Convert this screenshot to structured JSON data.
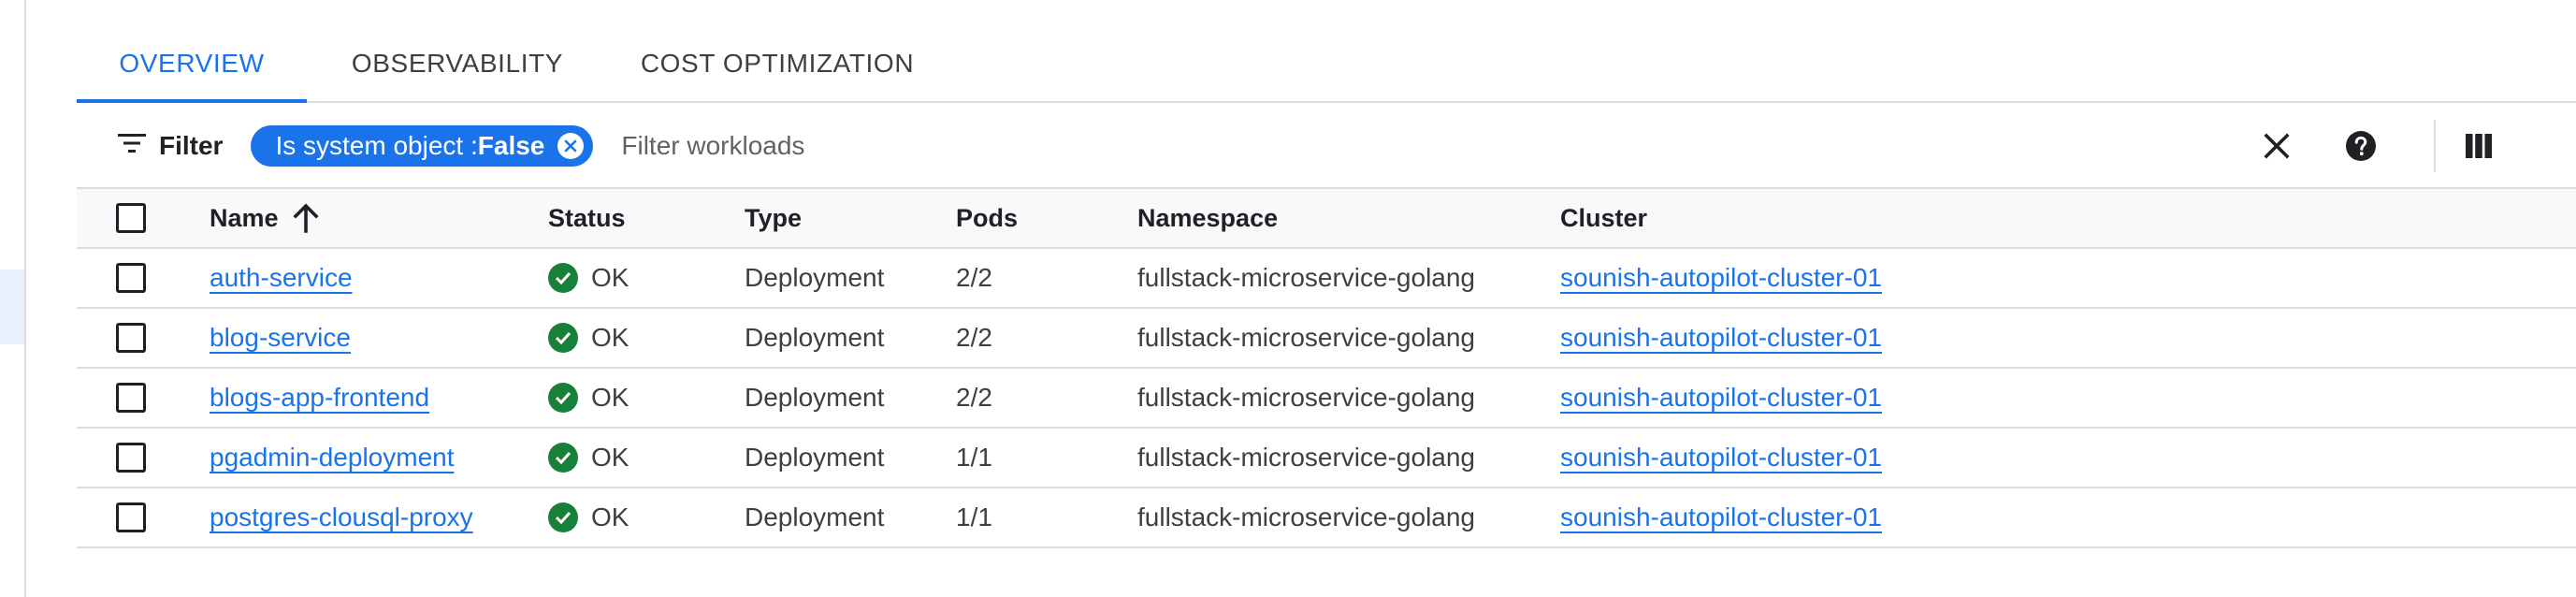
{
  "tabs": [
    {
      "label": "OVERVIEW",
      "active": true
    },
    {
      "label": "OBSERVABILITY",
      "active": false
    },
    {
      "label": "COST OPTIMIZATION",
      "active": false
    }
  ],
  "filter": {
    "button_label": "Filter",
    "chip_key": "Is system object : ",
    "chip_value": "False",
    "placeholder": "Filter workloads",
    "icons": {
      "filter": "filter-lines-icon",
      "chip_remove": "close-circle-icon",
      "clear": "close-icon",
      "help": "help-circle-icon",
      "columns": "column-display-icon"
    }
  },
  "table": {
    "columns": {
      "name": "Name",
      "status": "Status",
      "type": "Type",
      "pods": "Pods",
      "namespace": "Namespace",
      "cluster": "Cluster"
    },
    "sort": {
      "column": "Name",
      "direction": "ascending",
      "icon": "arrow-up-icon"
    },
    "rows": [
      {
        "name": "auth-service",
        "status": "OK",
        "type": "Deployment",
        "pods": "2/2",
        "namespace": "fullstack-microservice-golang",
        "cluster": "sounish-autopilot-cluster-01"
      },
      {
        "name": "blog-service",
        "status": "OK",
        "type": "Deployment",
        "pods": "2/2",
        "namespace": "fullstack-microservice-golang",
        "cluster": "sounish-autopilot-cluster-01"
      },
      {
        "name": "blogs-app-frontend",
        "status": "OK",
        "type": "Deployment",
        "pods": "2/2",
        "namespace": "fullstack-microservice-golang",
        "cluster": "sounish-autopilot-cluster-01"
      },
      {
        "name": "pgadmin-deployment",
        "status": "OK",
        "type": "Deployment",
        "pods": "1/1",
        "namespace": "fullstack-microservice-golang",
        "cluster": "sounish-autopilot-cluster-01"
      },
      {
        "name": "postgres-clousql-proxy",
        "status": "OK",
        "type": "Deployment",
        "pods": "1/1",
        "namespace": "fullstack-microservice-golang",
        "cluster": "sounish-autopilot-cluster-01"
      }
    ]
  },
  "colors": {
    "accent": "#1a73e8",
    "ok": "#188038",
    "divider": "#dadce0",
    "header_bg": "#f8f9fa"
  }
}
